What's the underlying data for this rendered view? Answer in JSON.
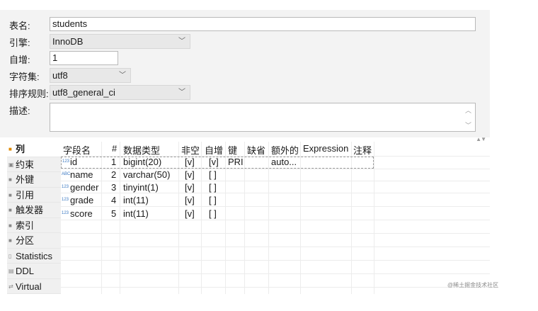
{
  "props": {
    "table_name": {
      "label": "表名:",
      "value": "students"
    },
    "engine": {
      "label": "引擎:",
      "value": "InnoDB"
    },
    "auto_increment": {
      "label": "自增:",
      "value": "1"
    },
    "charset": {
      "label": "字符集:",
      "value": "utf8"
    },
    "collation": {
      "label": "排序规则:",
      "value": "utf8_general_ci"
    },
    "description": {
      "label": "描述:",
      "value": ""
    }
  },
  "tabs": [
    {
      "label": "列",
      "icon": "columns-icon",
      "active": true
    },
    {
      "label": "约束",
      "icon": "constraint-icon"
    },
    {
      "label": "外键",
      "icon": "foreign-key-icon"
    },
    {
      "label": "引用",
      "icon": "reference-icon"
    },
    {
      "label": "触发器",
      "icon": "trigger-icon"
    },
    {
      "label": "索引",
      "icon": "index-icon"
    },
    {
      "label": "分区",
      "icon": "partition-icon"
    },
    {
      "label": "Statistics",
      "icon": "statistics-icon"
    },
    {
      "label": "DDL",
      "icon": "ddl-icon"
    },
    {
      "label": "Virtual",
      "icon": "virtual-icon"
    }
  ],
  "columns_table": {
    "headers": [
      "字段名",
      "#",
      "数据类型",
      "非空",
      "自增",
      "键",
      "缺省",
      "额外的",
      "Expression",
      "注释"
    ],
    "rows": [
      {
        "type_icon": "123",
        "name": "id",
        "num": "1",
        "type": "bigint(20)",
        "notnull": "[v]",
        "autoinc": "[v]",
        "key": "PRI",
        "default": "",
        "extra": "auto...",
        "expression": "",
        "comment": ""
      },
      {
        "type_icon": "ABC",
        "name": "name",
        "num": "2",
        "type": "varchar(50)",
        "notnull": "[v]",
        "autoinc": "[ ]",
        "key": "",
        "default": "",
        "extra": "",
        "expression": "",
        "comment": ""
      },
      {
        "type_icon": "123",
        "name": "gender",
        "num": "3",
        "type": "tinyint(1)",
        "notnull": "[v]",
        "autoinc": "[ ]",
        "key": "",
        "default": "",
        "extra": "",
        "expression": "",
        "comment": ""
      },
      {
        "type_icon": "123",
        "name": "grade",
        "num": "4",
        "type": "int(11)",
        "notnull": "[v]",
        "autoinc": "[ ]",
        "key": "",
        "default": "",
        "extra": "",
        "expression": "",
        "comment": ""
      },
      {
        "type_icon": "123",
        "name": "score",
        "num": "5",
        "type": "int(11)",
        "notnull": "[v]",
        "autoinc": "[ ]",
        "key": "",
        "default": "",
        "extra": "",
        "expression": "",
        "comment": ""
      }
    ]
  },
  "watermark": "@稀土掘金技术社区"
}
